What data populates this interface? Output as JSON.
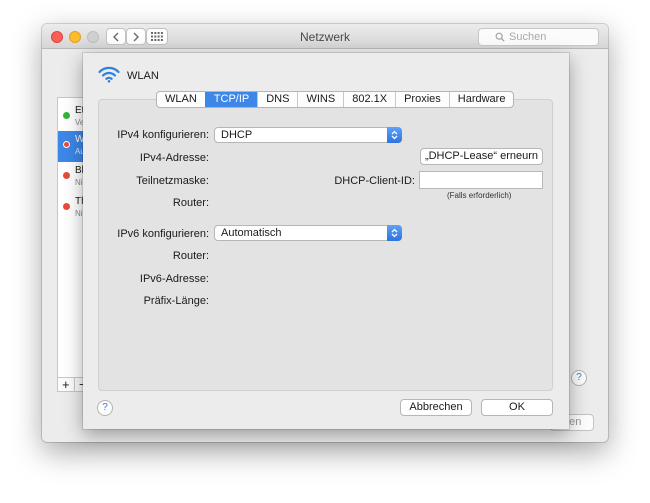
{
  "window": {
    "title": "Netzwerk",
    "search_placeholder": "Suchen",
    "back_button_partial": "den",
    "help_glyph": "?"
  },
  "sidebar": {
    "items": [
      {
        "name": "Et",
        "status": "Ve",
        "dot_color": "#2fb837"
      },
      {
        "name": "W",
        "status": "Au",
        "dot_color": "#e94b3c",
        "selected": true
      },
      {
        "name": "Bl",
        "status": "Ni",
        "dot_color": "#e94b3c"
      },
      {
        "name": "Th",
        "status": "Ni",
        "dot_color": "#e94b3c"
      }
    ],
    "add_label": "+",
    "remove_label": "−"
  },
  "sheet": {
    "interface_name": "WLAN",
    "tabs": [
      {
        "label": "WLAN",
        "active": false
      },
      {
        "label": "TCP/IP",
        "active": true
      },
      {
        "label": "DNS",
        "active": false
      },
      {
        "label": "WINS",
        "active": false
      },
      {
        "label": "802.1X",
        "active": false
      },
      {
        "label": "Proxies",
        "active": false
      },
      {
        "label": "Hardware",
        "active": false
      }
    ],
    "ipv4": {
      "configure_label": "IPv4 konfigurieren:",
      "configure_value": "DHCP",
      "address_label": "IPv4-Adresse:",
      "subnet_label": "Teilnetzmaske:",
      "router_label": "Router:",
      "renew_button": "„DHCP-Lease“ erneurn",
      "client_id_label": "DHCP-Client-ID:",
      "client_id_value": "",
      "client_id_hint": "(Falls erforderlich)"
    },
    "ipv6": {
      "configure_label": "IPv6 konfigurieren:",
      "configure_value": "Automatisch",
      "router_label": "Router:",
      "address_label": "IPv6-Adresse:",
      "prefix_label": "Präfix-Länge:"
    },
    "help_glyph": "?",
    "cancel_button": "Abbrechen",
    "ok_button": "OK"
  },
  "colors": {
    "accent": "#3d87e8",
    "close": "#fc5f57",
    "minimize": "#fdbc2e",
    "zoom_disabled": "#cfcfcf"
  }
}
